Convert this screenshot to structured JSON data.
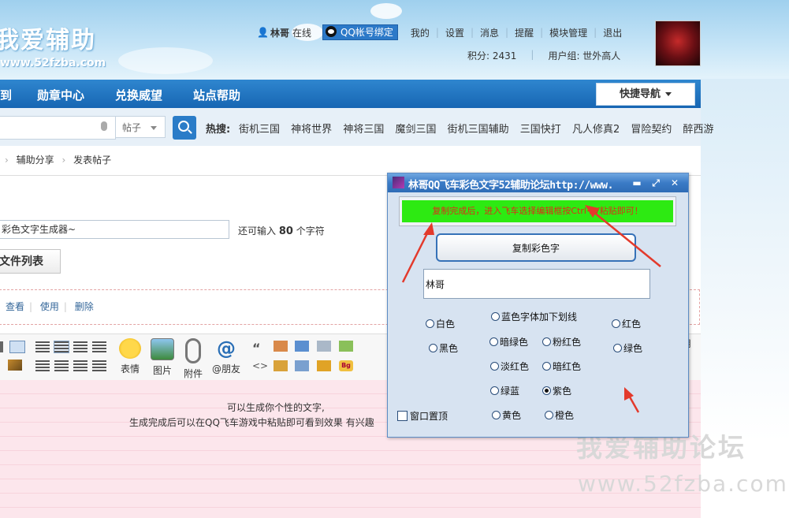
{
  "site": {
    "logo_text": "我爱辅助",
    "logo_url": "www.52fzba.com"
  },
  "userbar": {
    "username": "林哥",
    "status": "在线",
    "qq_bind": "QQ帐号绑定",
    "links": [
      "我的",
      "设置",
      "消息",
      "提醒",
      "模块管理",
      "退出"
    ],
    "points_label": "积分: 2431",
    "usergroup_label": "用户组: 世外高人"
  },
  "nav": {
    "items": [
      "到",
      "勋章中心",
      "兑换威望",
      "站点帮助"
    ],
    "quick_nav": "快捷导航"
  },
  "search": {
    "type": "帖子",
    "hot_label": "热搜:",
    "hot_links": [
      "街机三国",
      "神将世界",
      "神将三国",
      "魔剑三国",
      "街机三国辅助",
      "三国快打",
      "凡人修真2",
      "冒险契约",
      "醉西游"
    ]
  },
  "breadcrumb": [
    "辅助分享",
    "发表帖子"
  ],
  "form": {
    "title_value": "彩色文字生成器~",
    "remain_prefix": "还可输入",
    "remain_count": "80",
    "remain_suffix": "个字符",
    "file_list_button": "文件列表",
    "actions": [
      "查看",
      "使用",
      "删除"
    ]
  },
  "toolbar": {
    "emoji": "表情",
    "image": "图片",
    "attach": "附件",
    "at_friend": "@朋友",
    "edge_char": "用"
  },
  "editor": {
    "line1": "可以生成你个性的文字,",
    "line2": "生成完成后可以在QQ飞车游戏中粘贴即可看到效果  有兴趣"
  },
  "watermark": {
    "line1": "我爱辅助论坛",
    "line2": "www.52fzba.com"
  },
  "dialog": {
    "title": "林哥QQ飞车彩色文字52辅助论坛http://www.",
    "notice": "复制完成后，进入飞车选择编辑框按Ctrl+V粘贴即可！",
    "copy_button": "复制彩色字",
    "text_value": "林哥",
    "radios": {
      "white": "白色",
      "black": "黑色",
      "blue_underline": "蓝色字体加下划线",
      "dark_green": "暗绿色",
      "pink_red": "粉红色",
      "light_red": "淡红色",
      "dark_red": "暗红色",
      "green_blue": "绿蓝",
      "purple": "紫色",
      "yellow": "黄色",
      "orange": "橙色",
      "red": "红色",
      "green": "绿色"
    },
    "selected": "purple",
    "topmost_label": "窗口置顶",
    "minimize": "▬",
    "maximize": "⤢",
    "close": "✕"
  },
  "colors": {
    "nav_blue": "#1766b3",
    "notice_green": "#2dea12",
    "notice_text": "#e02a1a",
    "arrow_red": "#e33a2c"
  }
}
